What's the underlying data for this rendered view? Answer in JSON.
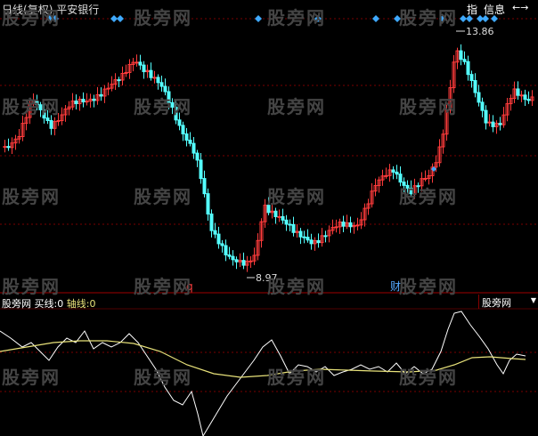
{
  "header": {
    "period": "日线",
    "adjust": "(复权)",
    "stock": "平安银行",
    "buttons": [
      "指",
      "信息"
    ],
    "nav_arrow": "←→"
  },
  "indicator": {
    "label": "股旁网",
    "buy_label": "买线:",
    "buy_value": "0",
    "axis_label": "轴线:",
    "axis_value": "0",
    "dropdown": "股旁网"
  },
  "annotations": {
    "high": "13.86",
    "low": "8.97",
    "marker_left": "q",
    "marker_right": "财"
  },
  "watermark": "股旁网",
  "colors": {
    "up": "#ff3b3b",
    "down": "#54ffff",
    "marker": "#3fa9ff",
    "curve_white": "#ffffff",
    "curve_yellow": "#e8e27a",
    "grid": "#7a0000"
  }
}
